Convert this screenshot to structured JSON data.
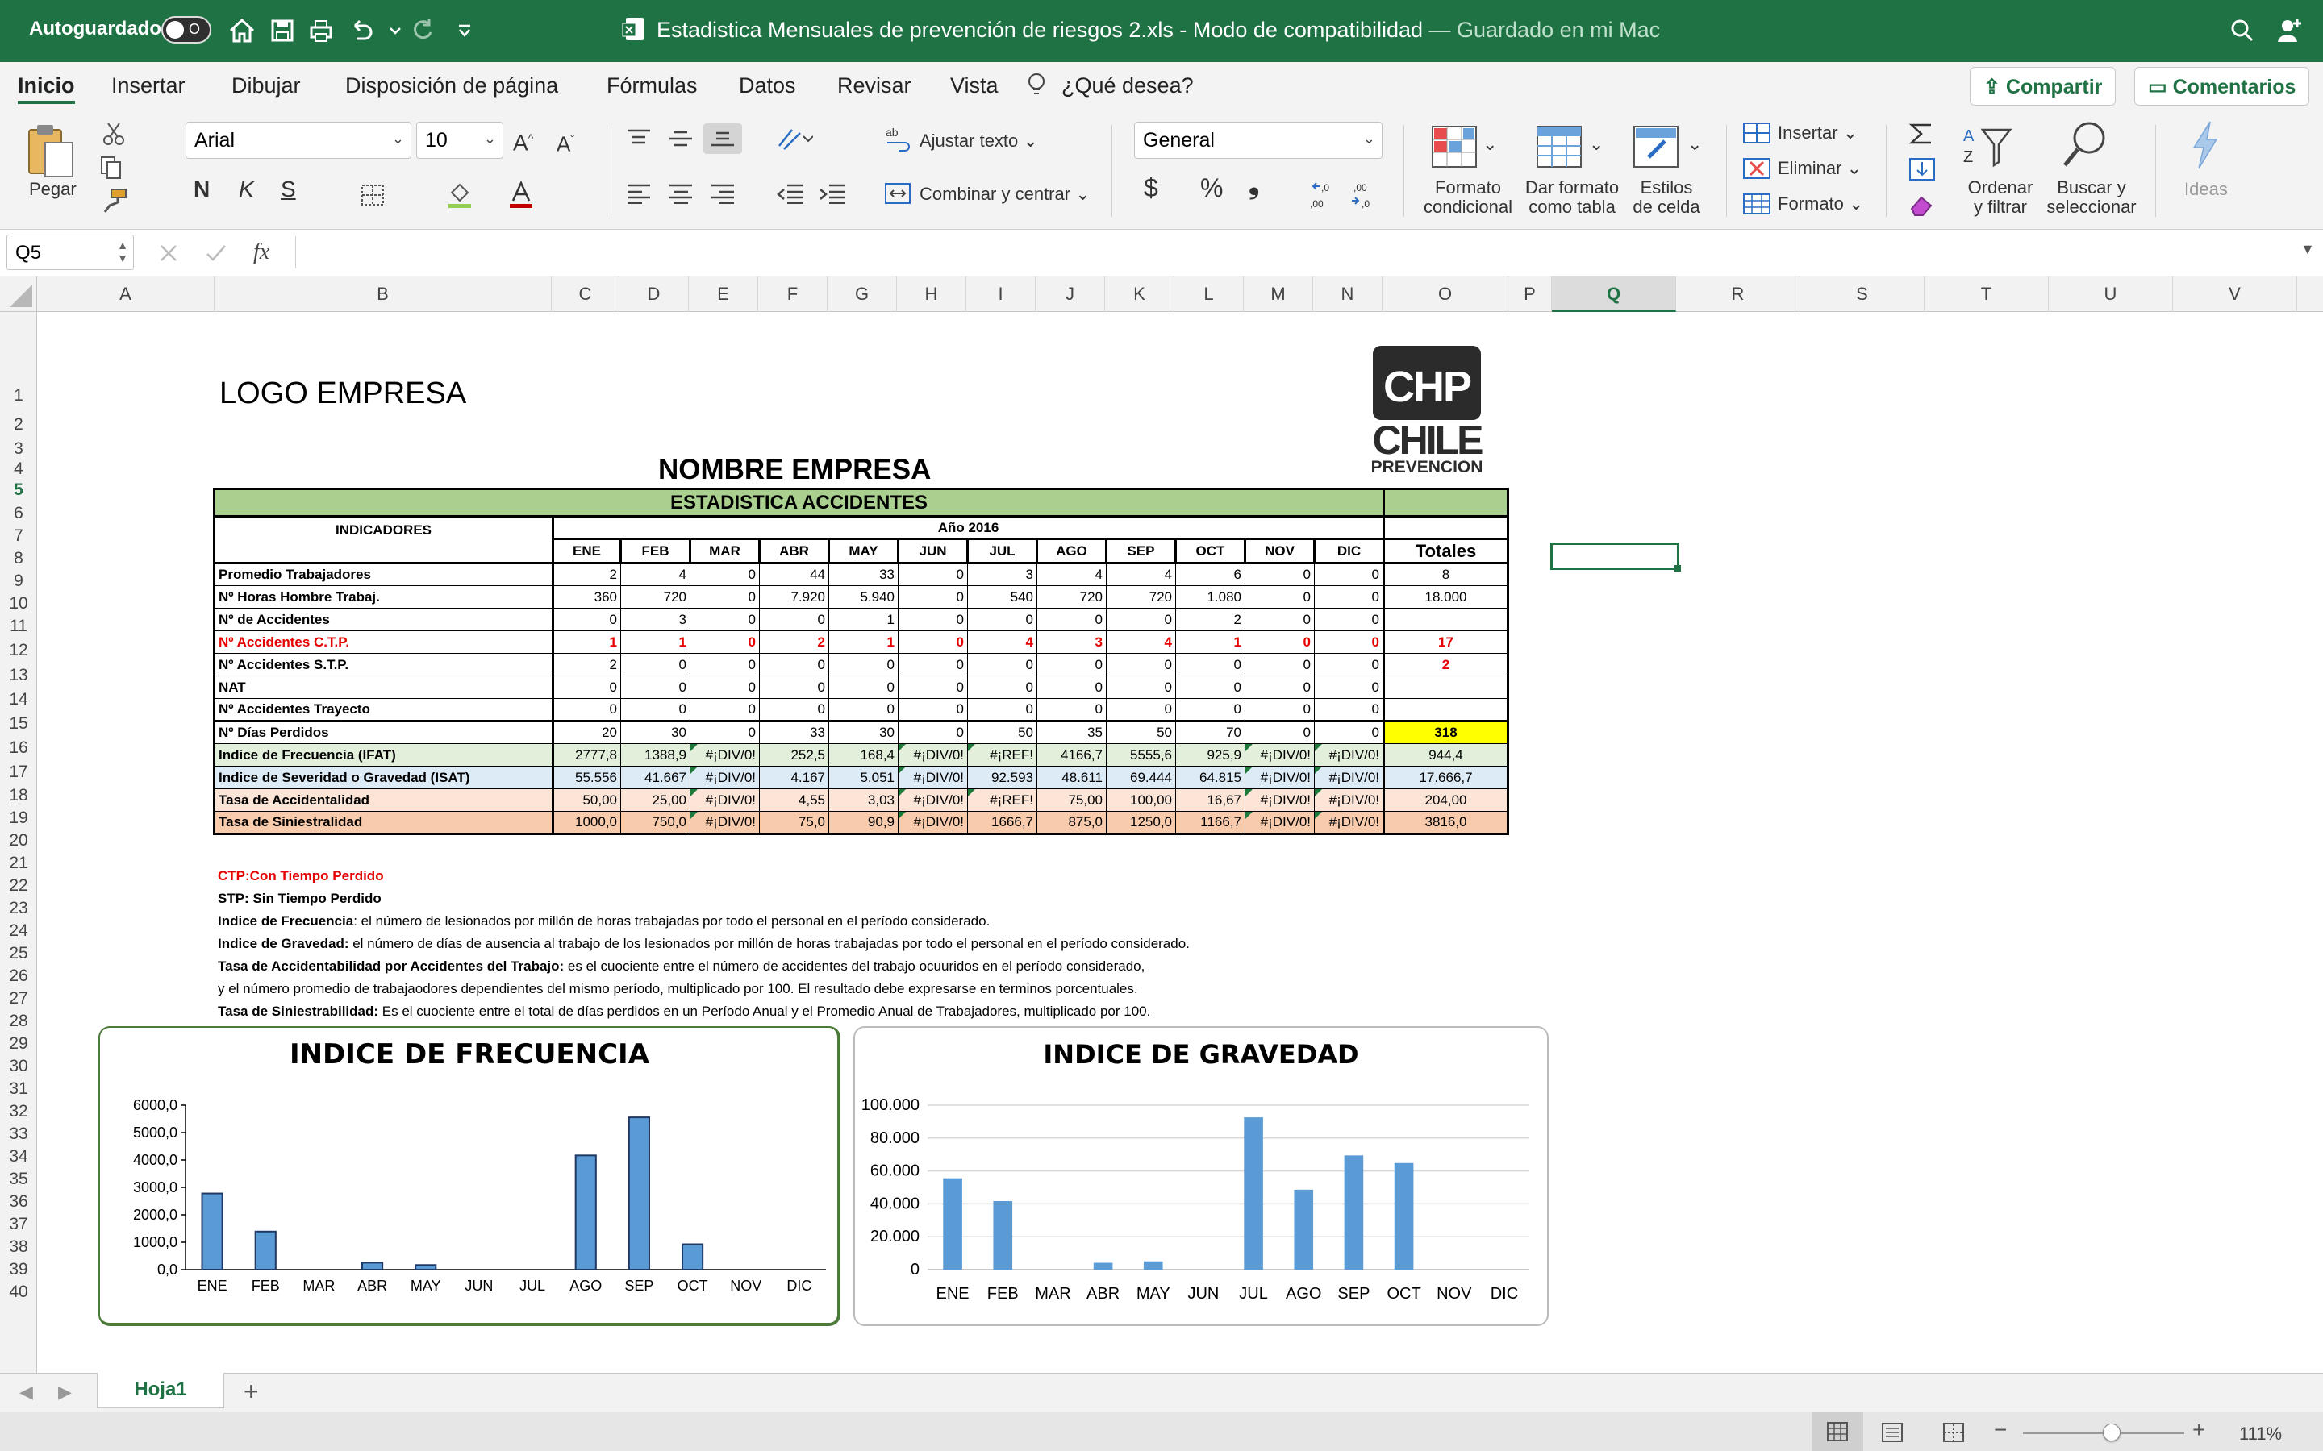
{
  "titlebar": {
    "autosave_label": "Autoguardado",
    "autosave_state": "O",
    "title_main": "Estadistica Mensuales de prevención de riesgos 2.xls  -  Modo de compatibilidad",
    "title_status": " — Guardado en mi Mac"
  },
  "menu": {
    "tabs": [
      "Inicio",
      "Insertar",
      "Dibujar",
      "Disposición de página",
      "Fórmulas",
      "Datos",
      "Revisar",
      "Vista"
    ],
    "tellme": "¿Qué desea?",
    "share": "Compartir",
    "comments": "Comentarios"
  },
  "ribbon": {
    "paste": "Pegar",
    "font_name": "Arial",
    "font_size": "10",
    "bold": "N",
    "italic": "K",
    "underline": "S",
    "wrap": "Ajustar texto",
    "merge": "Combinar y centrar",
    "number_format": "General",
    "currency": "$",
    "percent": "%",
    "comma": "❟",
    "cond_format": [
      "Formato",
      "condicional"
    ],
    "table_format": [
      "Dar formato",
      "como tabla"
    ],
    "cell_styles": [
      "Estilos",
      "de celda"
    ],
    "insert": "Insertar",
    "delete": "Eliminar",
    "format": "Formato",
    "sort": [
      "Ordenar",
      "y filtrar"
    ],
    "find": [
      "Buscar y",
      "seleccionar"
    ],
    "ideas": "Ideas"
  },
  "formula": {
    "name_box": "Q5",
    "fx": "fx"
  },
  "columns": [
    "A",
    "B",
    "C",
    "D",
    "E",
    "F",
    "G",
    "H",
    "I",
    "J",
    "K",
    "L",
    "M",
    "N",
    "O",
    "P",
    "Q",
    "R",
    "S",
    "T",
    "U",
    "V"
  ],
  "rows": [
    "1",
    "2",
    "3",
    "4",
    "5",
    "6",
    "7",
    "8",
    "9",
    "10",
    "11",
    "12",
    "13",
    "14",
    "15",
    "16",
    "17",
    "18",
    "19",
    "20",
    "21",
    "22",
    "23",
    "24",
    "25",
    "26",
    "27",
    "28",
    "29",
    "30",
    "31",
    "32",
    "33",
    "34",
    "35",
    "36",
    "37",
    "38",
    "39",
    "40"
  ],
  "sheet": {
    "logo_text": "LOGO EMPRESA",
    "company": "NOMBRE EMPRESA",
    "section": "ESTADISTICA ACCIDENTES",
    "indicators_label": "INDICADORES",
    "year_label": "Año 2016",
    "totals_label": "Totales",
    "months": [
      "ENE",
      "FEB",
      "MAR",
      "ABR",
      "MAY",
      "JUN",
      "JUL",
      "AGO",
      "SEP",
      "OCT",
      "NOV",
      "DIC"
    ],
    "table": [
      {
        "label": "Promedio Trabajadores",
        "values": [
          "2",
          "4",
          "0",
          "44",
          "33",
          "0",
          "3",
          "4",
          "4",
          "6",
          "0",
          "0"
        ],
        "total": "8",
        "style": "normal"
      },
      {
        "label": "Nº Horas Hombre Trabaj.",
        "values": [
          "360",
          "720",
          "0",
          "7.920",
          "5.940",
          "0",
          "540",
          "720",
          "720",
          "1.080",
          "0",
          "0"
        ],
        "total": "18.000",
        "style": "normal"
      },
      {
        "label": "Nº de Accidentes",
        "values": [
          "0",
          "3",
          "0",
          "0",
          "1",
          "0",
          "0",
          "0",
          "0",
          "2",
          "0",
          "0"
        ],
        "total": "",
        "style": "normal"
      },
      {
        "label": "Nº Accidentes C.T.P.",
        "values": [
          "1",
          "1",
          "0",
          "2",
          "1",
          "0",
          "4",
          "3",
          "4",
          "1",
          "0",
          "0"
        ],
        "total": "17",
        "style": "red"
      },
      {
        "label": "Nº Accidentes S.T.P.",
        "values": [
          "2",
          "0",
          "0",
          "0",
          "0",
          "0",
          "0",
          "0",
          "0",
          "0",
          "0",
          "0"
        ],
        "total": "2",
        "style": "red-total"
      },
      {
        "label": "NAT",
        "values": [
          "0",
          "0",
          "0",
          "0",
          "0",
          "0",
          "0",
          "0",
          "0",
          "0",
          "0",
          "0"
        ],
        "total": "",
        "style": "normal"
      },
      {
        "label": "Nº Accidentes Trayecto",
        "values": [
          "0",
          "0",
          "0",
          "0",
          "0",
          "0",
          "0",
          "0",
          "0",
          "0",
          "0",
          "0"
        ],
        "total": "",
        "style": "normal"
      },
      {
        "label": "Nº Días Perdidos",
        "values": [
          "20",
          "30",
          "0",
          "33",
          "30",
          "0",
          "50",
          "35",
          "50",
          "70",
          "0",
          "0"
        ],
        "total": "318",
        "style": "yellow-total"
      },
      {
        "label": "Indice de Frecuencia (IFAT)",
        "values": [
          "2777,8",
          "1388,9",
          "#¡DIV/0!",
          "252,5",
          "168,4",
          "#¡DIV/0!",
          "#¡REF!",
          "4166,7",
          "5555,6",
          "925,9",
          "#¡DIV/0!",
          "#¡DIV/0!"
        ],
        "total": "944,4",
        "style": "green"
      },
      {
        "label": "Indice de Severidad o Gravedad (ISAT)",
        "values": [
          "55.556",
          "41.667",
          "#¡DIV/0!",
          "4.167",
          "5.051",
          "#¡DIV/0!",
          "92.593",
          "48.611",
          "69.444",
          "64.815",
          "#¡DIV/0!",
          "#¡DIV/0!"
        ],
        "total": "17.666,7",
        "style": "blue"
      },
      {
        "label": "Tasa de Accidentalidad",
        "values": [
          "50,00",
          "25,00",
          "#¡DIV/0!",
          "4,55",
          "3,03",
          "#¡DIV/0!",
          "#¡REF!",
          "75,00",
          "100,00",
          "16,67",
          "#¡DIV/0!",
          "#¡DIV/0!"
        ],
        "total": "204,00",
        "style": "peach"
      },
      {
        "label": "Tasa de Siniestralidad",
        "values": [
          "1000,0",
          "750,0",
          "#¡DIV/0!",
          "75,0",
          "90,9",
          "#¡DIV/0!",
          "1666,7",
          "875,0",
          "1250,0",
          "1166,7",
          "#¡DIV/0!",
          "#¡DIV/0!"
        ],
        "total": "3816,0",
        "style": "salmon"
      }
    ],
    "notes": [
      {
        "bold": "CTP:Con Tiempo Perdido",
        "text": "",
        "red": true
      },
      {
        "bold": "STP: Sin Tiempo Perdido",
        "text": "",
        "red": false
      },
      {
        "bold": "Indice de Frecuencia",
        "text": ": el número de lesionados por millón de horas trabajadas por todo el personal en el período considerado.",
        "red": false
      },
      {
        "bold": "Indice de Gravedad:",
        "text": " el número de días de ausencia al trabajo de los lesionados por millón de horas trabajadas por todo el personal en el período considerado.",
        "red": false
      },
      {
        "bold": "Tasa de Accidentabilidad por Accidentes del Trabajo:",
        "text": " es el cuociente entre el número de accidentes del trabajo ocuuridos en el período considerado,",
        "red": false
      },
      {
        "bold": "",
        "text": "y el número promedio de trabajaodores dependientes del mismo período, multiplicado por 100. El resultado debe expresarse en terminos porcentuales.",
        "red": false
      },
      {
        "bold": "Tasa de Siniestrabilidad:",
        "text": " Es el cuociente entre el total de días perdidos en un Período Anual y el Promedio Anual de Trabajadores, multiplicado por 100.",
        "red": false
      }
    ],
    "logo_img": {
      "line1": "CHP",
      "line2": "CHILE",
      "line3": "PREVENCION"
    }
  },
  "chart_data": [
    {
      "type": "bar",
      "title": "INDICE DE FRECUENCIA",
      "categories": [
        "ENE",
        "FEB",
        "MAR",
        "ABR",
        "MAY",
        "JUN",
        "JUL",
        "AGO",
        "SEP",
        "OCT",
        "NOV",
        "DIC"
      ],
      "values": [
        2777.8,
        1388.9,
        0,
        252.5,
        168.4,
        0,
        0,
        4166.7,
        5555.6,
        925.9,
        0,
        0
      ],
      "ylim": [
        0,
        6000
      ],
      "yticks": [
        "0,0",
        "1000,0",
        "2000,0",
        "3000,0",
        "4000,0",
        "5000,0",
        "6000,0"
      ],
      "grid": false
    },
    {
      "type": "bar",
      "title": "INDICE DE GRAVEDAD",
      "categories": [
        "ENE",
        "FEB",
        "MAR",
        "ABR",
        "MAY",
        "JUN",
        "JUL",
        "AGO",
        "SEP",
        "OCT",
        "NOV",
        "DIC"
      ],
      "values": [
        55556,
        41667,
        0,
        4167,
        5051,
        0,
        92593,
        48611,
        69444,
        64815,
        0,
        0
      ],
      "ylim": [
        0,
        100000
      ],
      "yticks": [
        "0",
        "20.000",
        "40.000",
        "60.000",
        "80.000",
        "100.000"
      ],
      "grid": true
    }
  ],
  "sheetbar": {
    "tab": "Hoja1",
    "add": "+"
  },
  "status": {
    "zoom": "111%",
    "zoom_fraction": 0.55
  },
  "colors": {
    "excel_green": "#1f7244",
    "row_green": "#e2efda",
    "row_blue": "#ddebf7",
    "row_peach": "#fce4d6",
    "row_salmon": "#f8cbad",
    "header_green": "#a9d08e",
    "yellow": "#ffff00",
    "bar_blue": "#5b9bd5"
  }
}
